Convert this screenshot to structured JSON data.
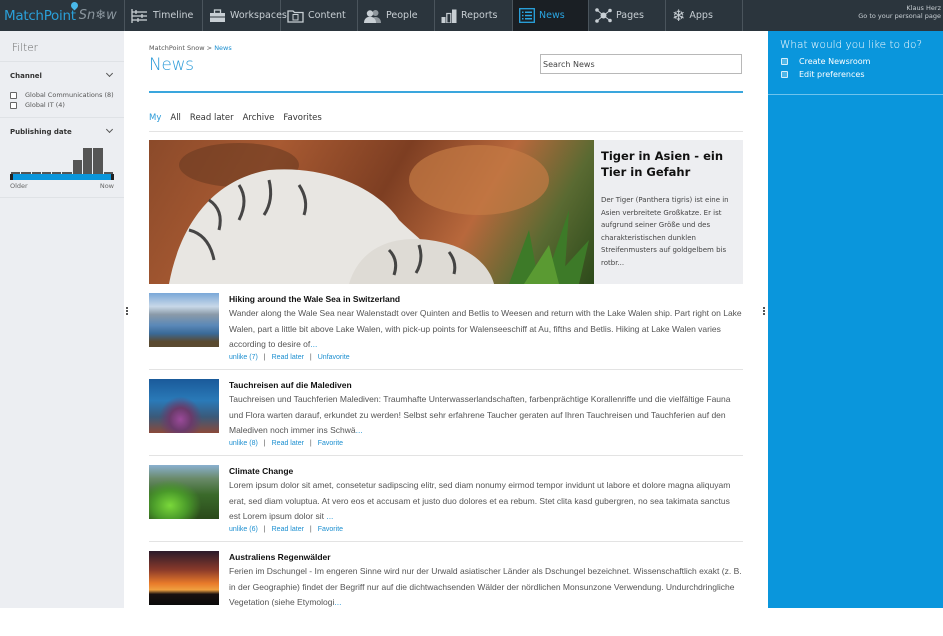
{
  "app": {
    "logo_primary": "MatchPoint",
    "logo_secondary": "Sn❄w"
  },
  "nav": {
    "items": [
      {
        "label": "Timeline",
        "icon": "timeline-icon",
        "active": false
      },
      {
        "label": "Workspaces",
        "icon": "briefcase-icon",
        "active": false
      },
      {
        "label": "Content",
        "icon": "folder-icon",
        "active": false
      },
      {
        "label": "People",
        "icon": "people-icon",
        "active": false
      },
      {
        "label": "Reports",
        "icon": "bar-chart-icon",
        "active": false
      },
      {
        "label": "News",
        "icon": "news-list-icon",
        "active": true
      },
      {
        "label": "Pages",
        "icon": "network-icon",
        "active": false
      },
      {
        "label": "Apps",
        "icon": "snowflake-icon",
        "active": false
      }
    ]
  },
  "user": {
    "name": "Klaus Herz",
    "personal_link": "Go to your personal page"
  },
  "filter": {
    "title": "Filter",
    "channel": {
      "heading": "Channel",
      "options": [
        {
          "label": "Global Communications (8)",
          "checked": false
        },
        {
          "label": "Global IT (4)",
          "checked": false
        }
      ]
    },
    "publishing_date": {
      "heading": "Publishing date",
      "histogram_relative_counts": [
        0,
        0,
        0,
        0,
        0,
        0,
        0.55,
        1,
        1,
        0
      ],
      "range_start_label": "Older",
      "range_end_label": "Now"
    }
  },
  "breadcrumb": {
    "root": "MatchPoint Snow",
    "separator": ">",
    "current": "News"
  },
  "page_title": "News",
  "search": {
    "placeholder": "Search News"
  },
  "tabs": [
    {
      "label": "My",
      "active": true
    },
    {
      "label": "All",
      "active": false
    },
    {
      "label": "Read later",
      "active": false
    },
    {
      "label": "Archive",
      "active": false
    },
    {
      "label": "Favorites",
      "active": false
    }
  ],
  "featured": {
    "title": "Tiger in Asien - ein Tier in Gefahr",
    "excerpt": "Der Tiger (Panthera tigris) ist eine in Asien verbreitete Großkatze. Er ist aufgrund seiner Größe und des charakteristischen dunklen Streifenmusters auf goldgelbem bis rotbr..."
  },
  "articles": [
    {
      "title": "Hiking around the Wale Sea in Switzerland",
      "excerpt": "Wander along the Wale Sea near Walenstadt over Quinten and Betlis to Weesen and return with the Lake Walen ship. Part right on Lake Walen, part a little bit above Lake Walen, with pick-up points for Walenseeschiff at Au, fifths and Betlis. Hiking at Lake Walen varies according to desire of",
      "ellipsis": "...",
      "actions": [
        "unlike (7)",
        "Read later",
        "Unfavorite"
      ]
    },
    {
      "title": "Tauchreisen auf die Malediven",
      "excerpt": "Tauchreisen und Tauchferien Malediven: Traumhafte Unterwasserlandschaften, farbenprächtige Korallenriffe und die vielfältige Fauna und Flora warten darauf, erkundet zu werden! Selbst sehr erfahrene Taucher geraten auf Ihren Tauchreisen und Tauchferien auf den Malediven noch immer ins Schwä",
      "ellipsis": "...",
      "actions": [
        "unlike (8)",
        "Read later",
        "Favorite"
      ]
    },
    {
      "title": "Climate Change",
      "excerpt": "Lorem ipsum dolor sit amet, consetetur sadipscing elitr, sed diam nonumy eirmod tempor invidunt ut labore et dolore magna aliquyam erat, sed diam voluptua. At vero eos et accusam et justo duo dolores et ea rebum. Stet clita kasd gubergren, no sea takimata sanctus est Lorem ipsum dolor sit ",
      "ellipsis": "...",
      "actions": [
        "unlike (6)",
        "Read later",
        "Favorite"
      ]
    },
    {
      "title": "Australiens Regenwälder",
      "excerpt": "Ferien im Dschungel - Im engeren Sinne wird nur der Urwald asiatischer Länder als Dschungel bezeichnet. Wissenschaftlich exakt (z. B. in der Geographie) findet der Begriff nur auf die dichtwachsenden Wälder der nördlichen Monsunzone Verwendung. Undurchdringliche Vegetation (siehe Etymologi",
      "ellipsis": "...",
      "actions": []
    }
  ],
  "actions_panel": {
    "title": "What would you like to do?",
    "links": [
      {
        "label": "Create Newsroom",
        "icon": "newsroom-icon"
      },
      {
        "label": "Edit preferences",
        "icon": "preferences-icon"
      }
    ]
  },
  "colors": {
    "accent": "#0a96dc",
    "topbar": "#2b353d",
    "sidebar": "#eceef2"
  }
}
